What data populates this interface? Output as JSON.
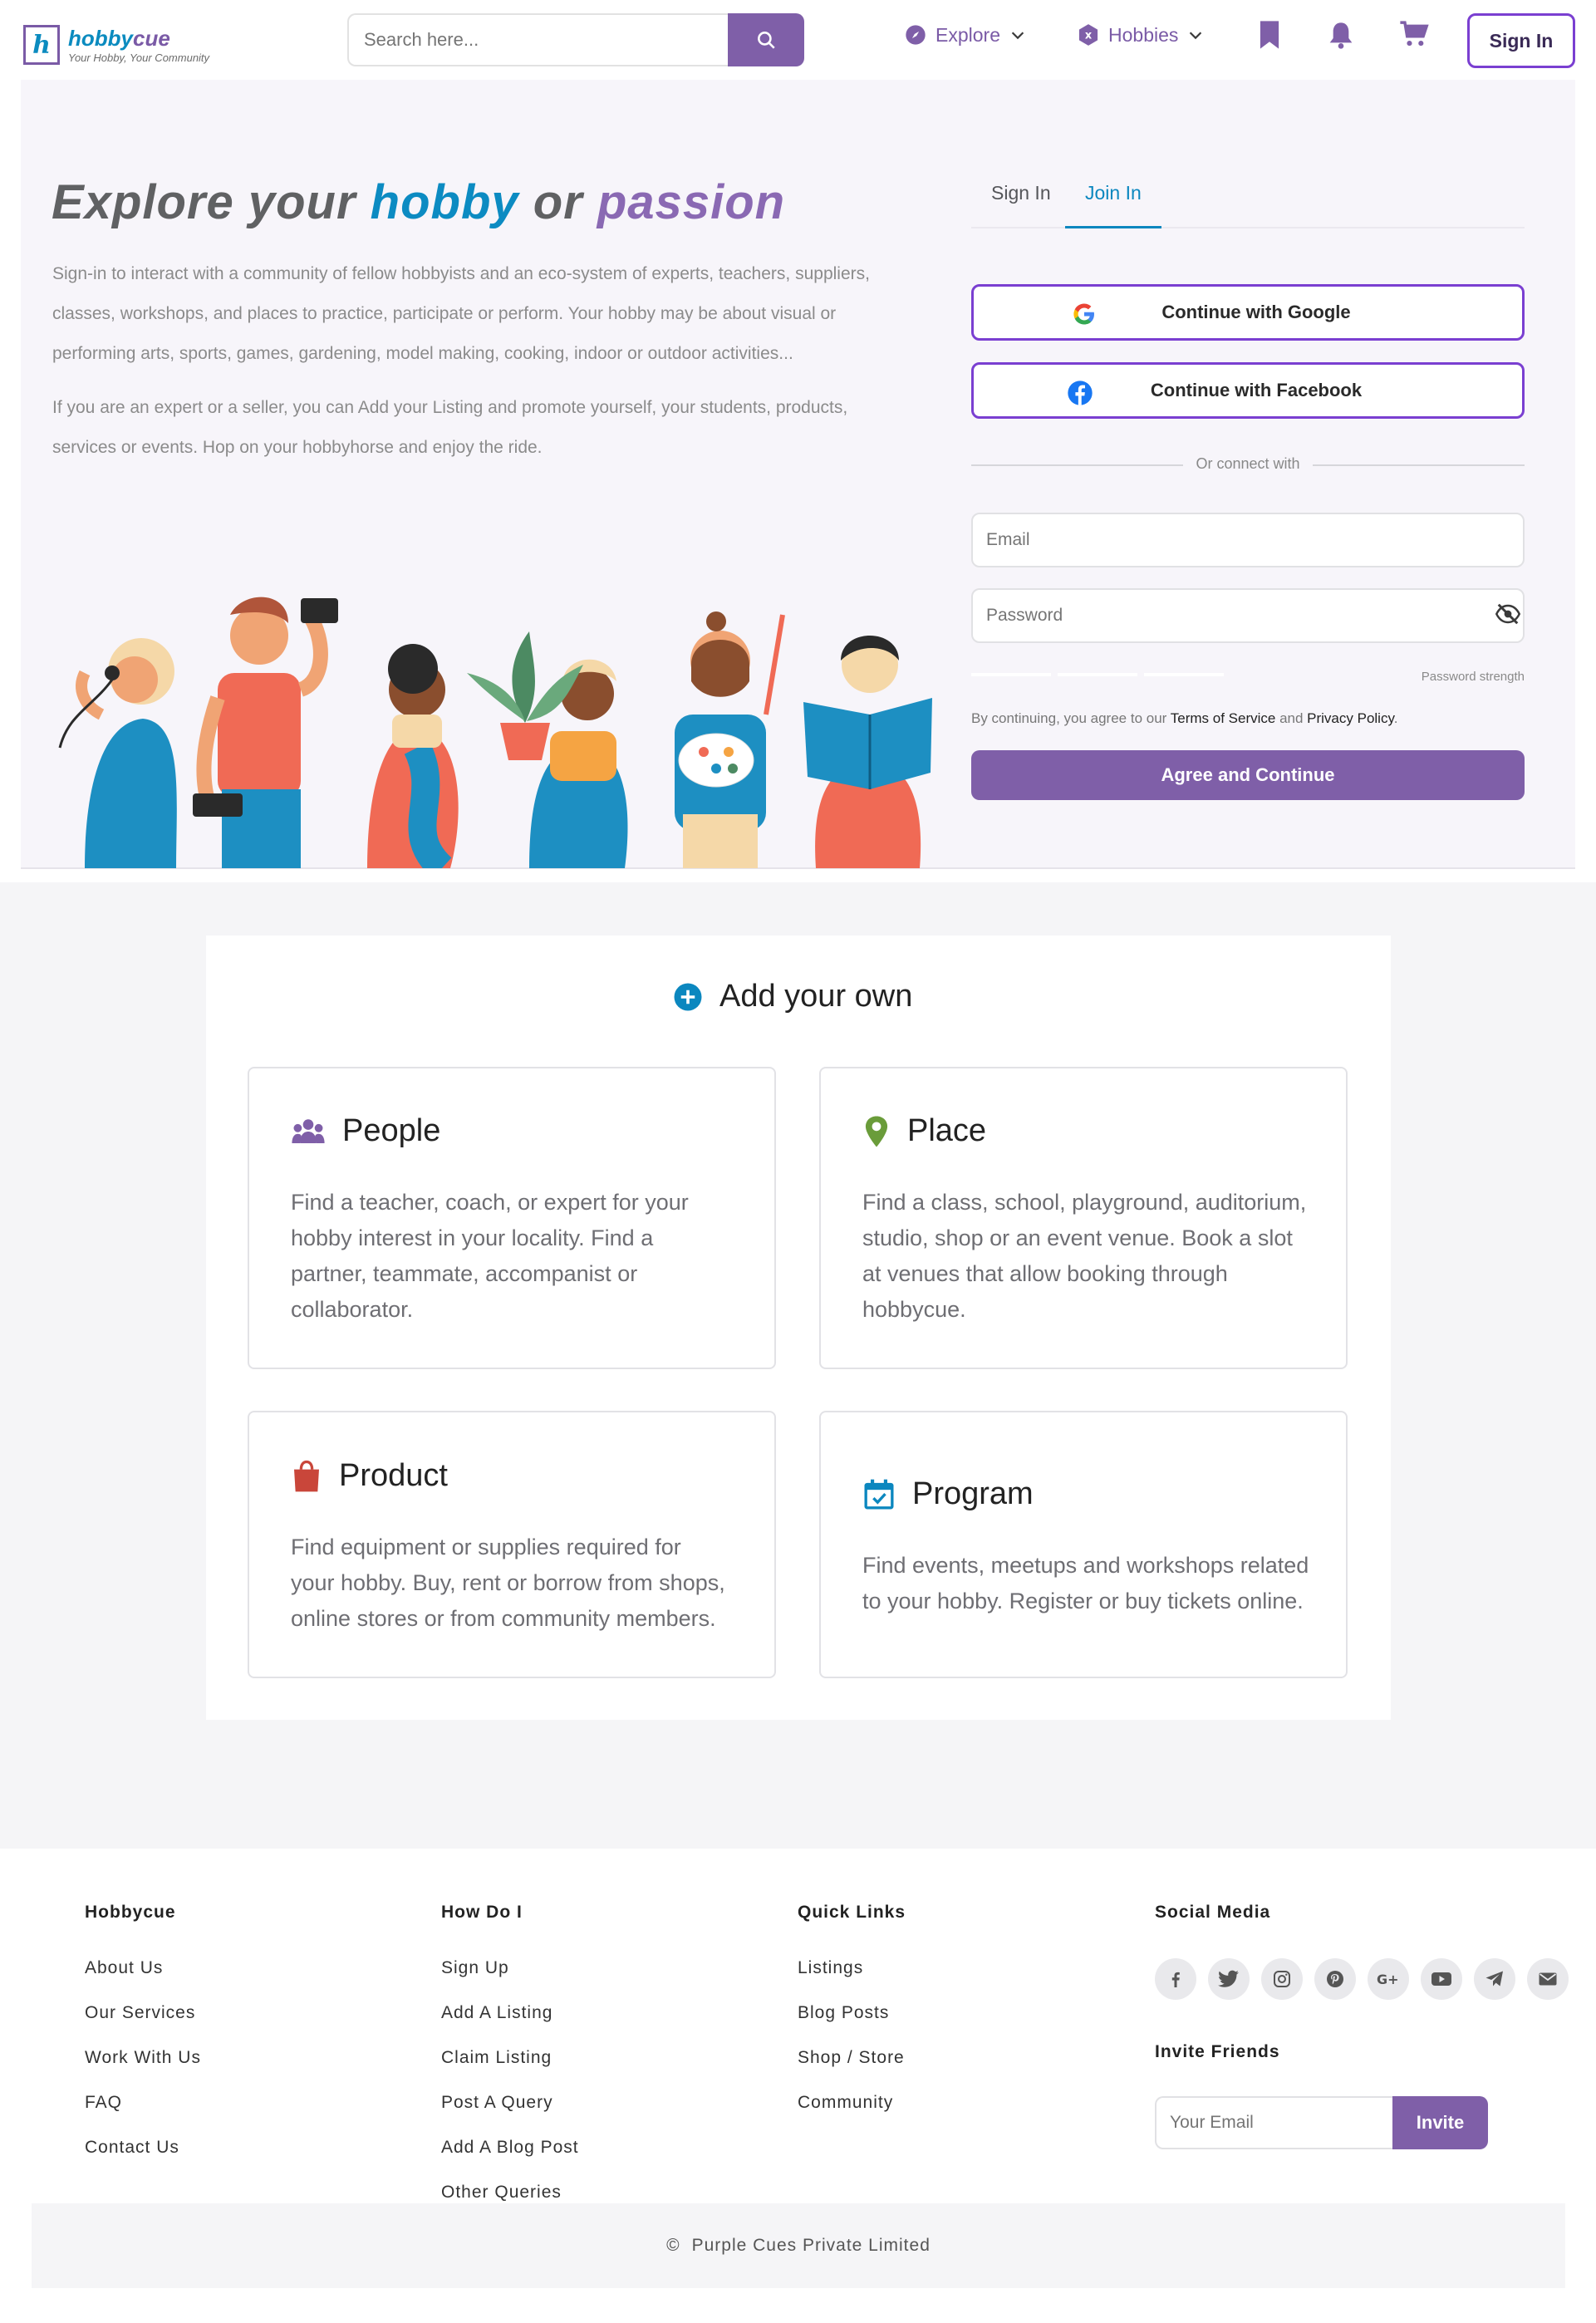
{
  "brand": {
    "letter": "h",
    "name_part1": "hobby",
    "name_part2": "cue",
    "tagline": "Your Hobby, Your Community"
  },
  "search": {
    "placeholder": "Search here..."
  },
  "nav": {
    "explore": "Explore",
    "hobbies": "Hobbies",
    "signin": "Sign In"
  },
  "hero": {
    "title_1": "Explore your ",
    "title_2": "hobby",
    "title_3": " or ",
    "title_4": "passion",
    "para1_line1": "Sign-in to interact with a community of fellow hobbyists and an eco-system of experts, teachers, suppliers,",
    "para1_line2": "classes, workshops, and places to practice, participate or perform. Your hobby may be about visual or",
    "para1_line3": "performing arts, sports, games, gardening, model making, cooking, indoor or outdoor activities...",
    "para2_line1": "If you are an expert or a seller, you can Add your Listing and promote yourself, your students, products,",
    "para2_line2": "services or events. Hop on your hobbyhorse and enjoy the ride."
  },
  "auth": {
    "tab_signin": "Sign In",
    "tab_join": "Join In",
    "google": "Continue with Google",
    "facebook": "Continue with Facebook",
    "or_connect": "Or connect with",
    "email_placeholder": "Email",
    "password_placeholder": "Password",
    "password_strength": "Password strength",
    "terms_prefix": "By continuing, you agree to our ",
    "terms_link": "Terms of Service",
    "terms_and": " and ",
    "privacy_link": "Privacy Policy",
    "terms_suffix": ".",
    "agree": "Agree and Continue"
  },
  "add_section": {
    "title": "Add your own",
    "cards": [
      {
        "title": "People",
        "lines": [
          "Find a teacher, coach, or expert for your",
          "hobby interest in your locality. Find a",
          "partner, teammate, accompanist or",
          "collaborator."
        ]
      },
      {
        "title": "Place",
        "lines": [
          "Find a class, school, playground, auditorium,",
          "studio, shop or an event venue. Book a slot",
          "at venues that allow booking through",
          "hobbycue."
        ]
      },
      {
        "title": "Product",
        "lines": [
          "Find equipment or supplies required for",
          "your hobby. Buy, rent or borrow from shops,",
          "online stores or from community members."
        ]
      },
      {
        "title": "Program",
        "lines": [
          "Find events, meetups and workshops related",
          "to your hobby. Register or buy tickets online."
        ]
      }
    ]
  },
  "footer": {
    "col1": {
      "title": "Hobbycue",
      "links": [
        "About Us",
        "Our Services",
        "Work With Us",
        "FAQ",
        "Contact Us"
      ]
    },
    "col2": {
      "title": "How Do I",
      "links": [
        "Sign Up",
        "Add A Listing",
        "Claim Listing",
        "Post A Query",
        "Add A Blog Post",
        "Other Queries"
      ]
    },
    "col3": {
      "title": "Quick Links",
      "links": [
        "Listings",
        "Blog Posts",
        "Shop / Store",
        "Community"
      ]
    },
    "social": {
      "title": "Social Media",
      "icons": [
        "facebook-icon",
        "twitter-icon",
        "instagram-icon",
        "pinterest-icon",
        "google-plus-icon",
        "youtube-icon",
        "telegram-icon",
        "mail-icon"
      ]
    },
    "invite": {
      "title": "Invite Friends",
      "placeholder": "Your Email",
      "button": "Invite"
    },
    "copyright_symbol": "©",
    "copyright": "Purple Cues Private Limited"
  },
  "colors": {
    "purple": "#7f5fa8",
    "blue": "#0b87bf",
    "border_purple": "#7a3fd1"
  }
}
